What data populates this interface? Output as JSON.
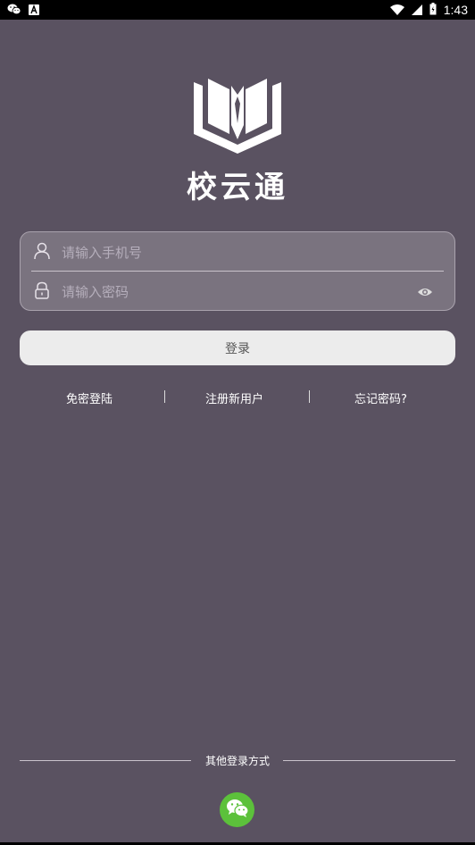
{
  "status_bar": {
    "time": "1:43",
    "left_icons": [
      "wechat-icon",
      "a-notification-icon"
    ],
    "right_icons": [
      "wifi-icon",
      "signal-icon",
      "battery-icon"
    ]
  },
  "app": {
    "name": "校云通",
    "logo_icon": "book-logo-icon"
  },
  "login_form": {
    "phone_placeholder": "请输入手机号",
    "phone_value": "",
    "password_placeholder": "请输入密码",
    "password_value": "",
    "login_button_label": "登录"
  },
  "links": {
    "passwordless_login": "免密登陆",
    "register": "注册新用户",
    "forgot_password": "忘记密码?"
  },
  "other_login": {
    "label": "其他登录方式",
    "wechat_icon": "wechat-icon"
  },
  "colors": {
    "background": "#5a5261",
    "card": "#7a737f",
    "button": "#ececec",
    "wechat": "#5cc13b"
  }
}
